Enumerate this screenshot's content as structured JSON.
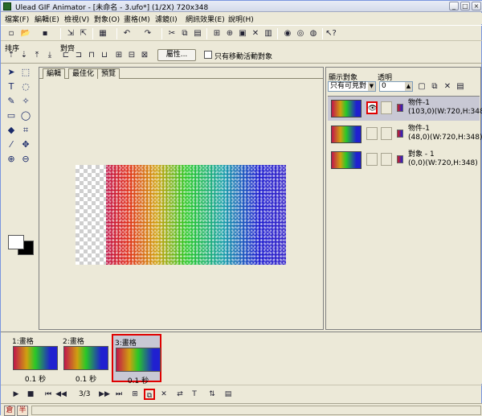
{
  "window": {
    "title": "Ulead GIF Animator - [未命名 - 3.ufo*] (1/2X) 720x348",
    "buttons": {
      "minimize": "_",
      "maximize": "□",
      "close": "×"
    }
  },
  "menubar": {
    "items": [
      "檔案(F)",
      "編輯(E)",
      "檢視(V)",
      "對象(O)",
      "畫格(M)",
      "濾鏡(I)",
      "網訊效果(E)",
      "說明(H)"
    ]
  },
  "toolbar": {
    "icons": [
      "new-icon",
      "open-icon",
      "save-icon",
      "import-icon",
      "export-icon",
      "color-icon",
      "undo-icon",
      "redo-icon",
      "cut-icon",
      "copy-icon",
      "paste-icon",
      "frame-icon",
      "add-icon",
      "delete-icon",
      "cancel-icon",
      "web-icon",
      "preview-icon",
      "browser-icon",
      "help-icon"
    ]
  },
  "arrange": {
    "sort_label": "排序",
    "align_label": "對齊",
    "properties_label": "屬性...",
    "move_active_label": "只有移動活動對象"
  },
  "tabs": [
    "編輯",
    "最佳化",
    "預覽"
  ],
  "right_panel": {
    "show_objects_label": "顯示對象",
    "transparency_label": "透明",
    "show_select_value": "只有可見對",
    "transparency_value": "0",
    "objects": [
      {
        "name": "物件-1",
        "info": "(103,0)(W:720,H:348)",
        "selected": true,
        "visible": true
      },
      {
        "name": "物件-1",
        "info": "(48,0)(W:720,H:348)",
        "selected": false,
        "visible": false
      },
      {
        "name": "對象 - 1",
        "info": "(0,0)(W:720,H:348)",
        "selected": false,
        "visible": false
      }
    ]
  },
  "frames": [
    {
      "label": "1:畫格",
      "time": "0.1 秒",
      "selected": false
    },
    {
      "label": "2:畫格",
      "time": "0.1 秒",
      "selected": false
    },
    {
      "label": "3:畫格",
      "time": "0.1 秒",
      "selected": true
    }
  ],
  "playbar": {
    "frame_counter": "3/3"
  },
  "statusbar": {
    "ime_mode": "倉",
    "ime_width": "半"
  }
}
